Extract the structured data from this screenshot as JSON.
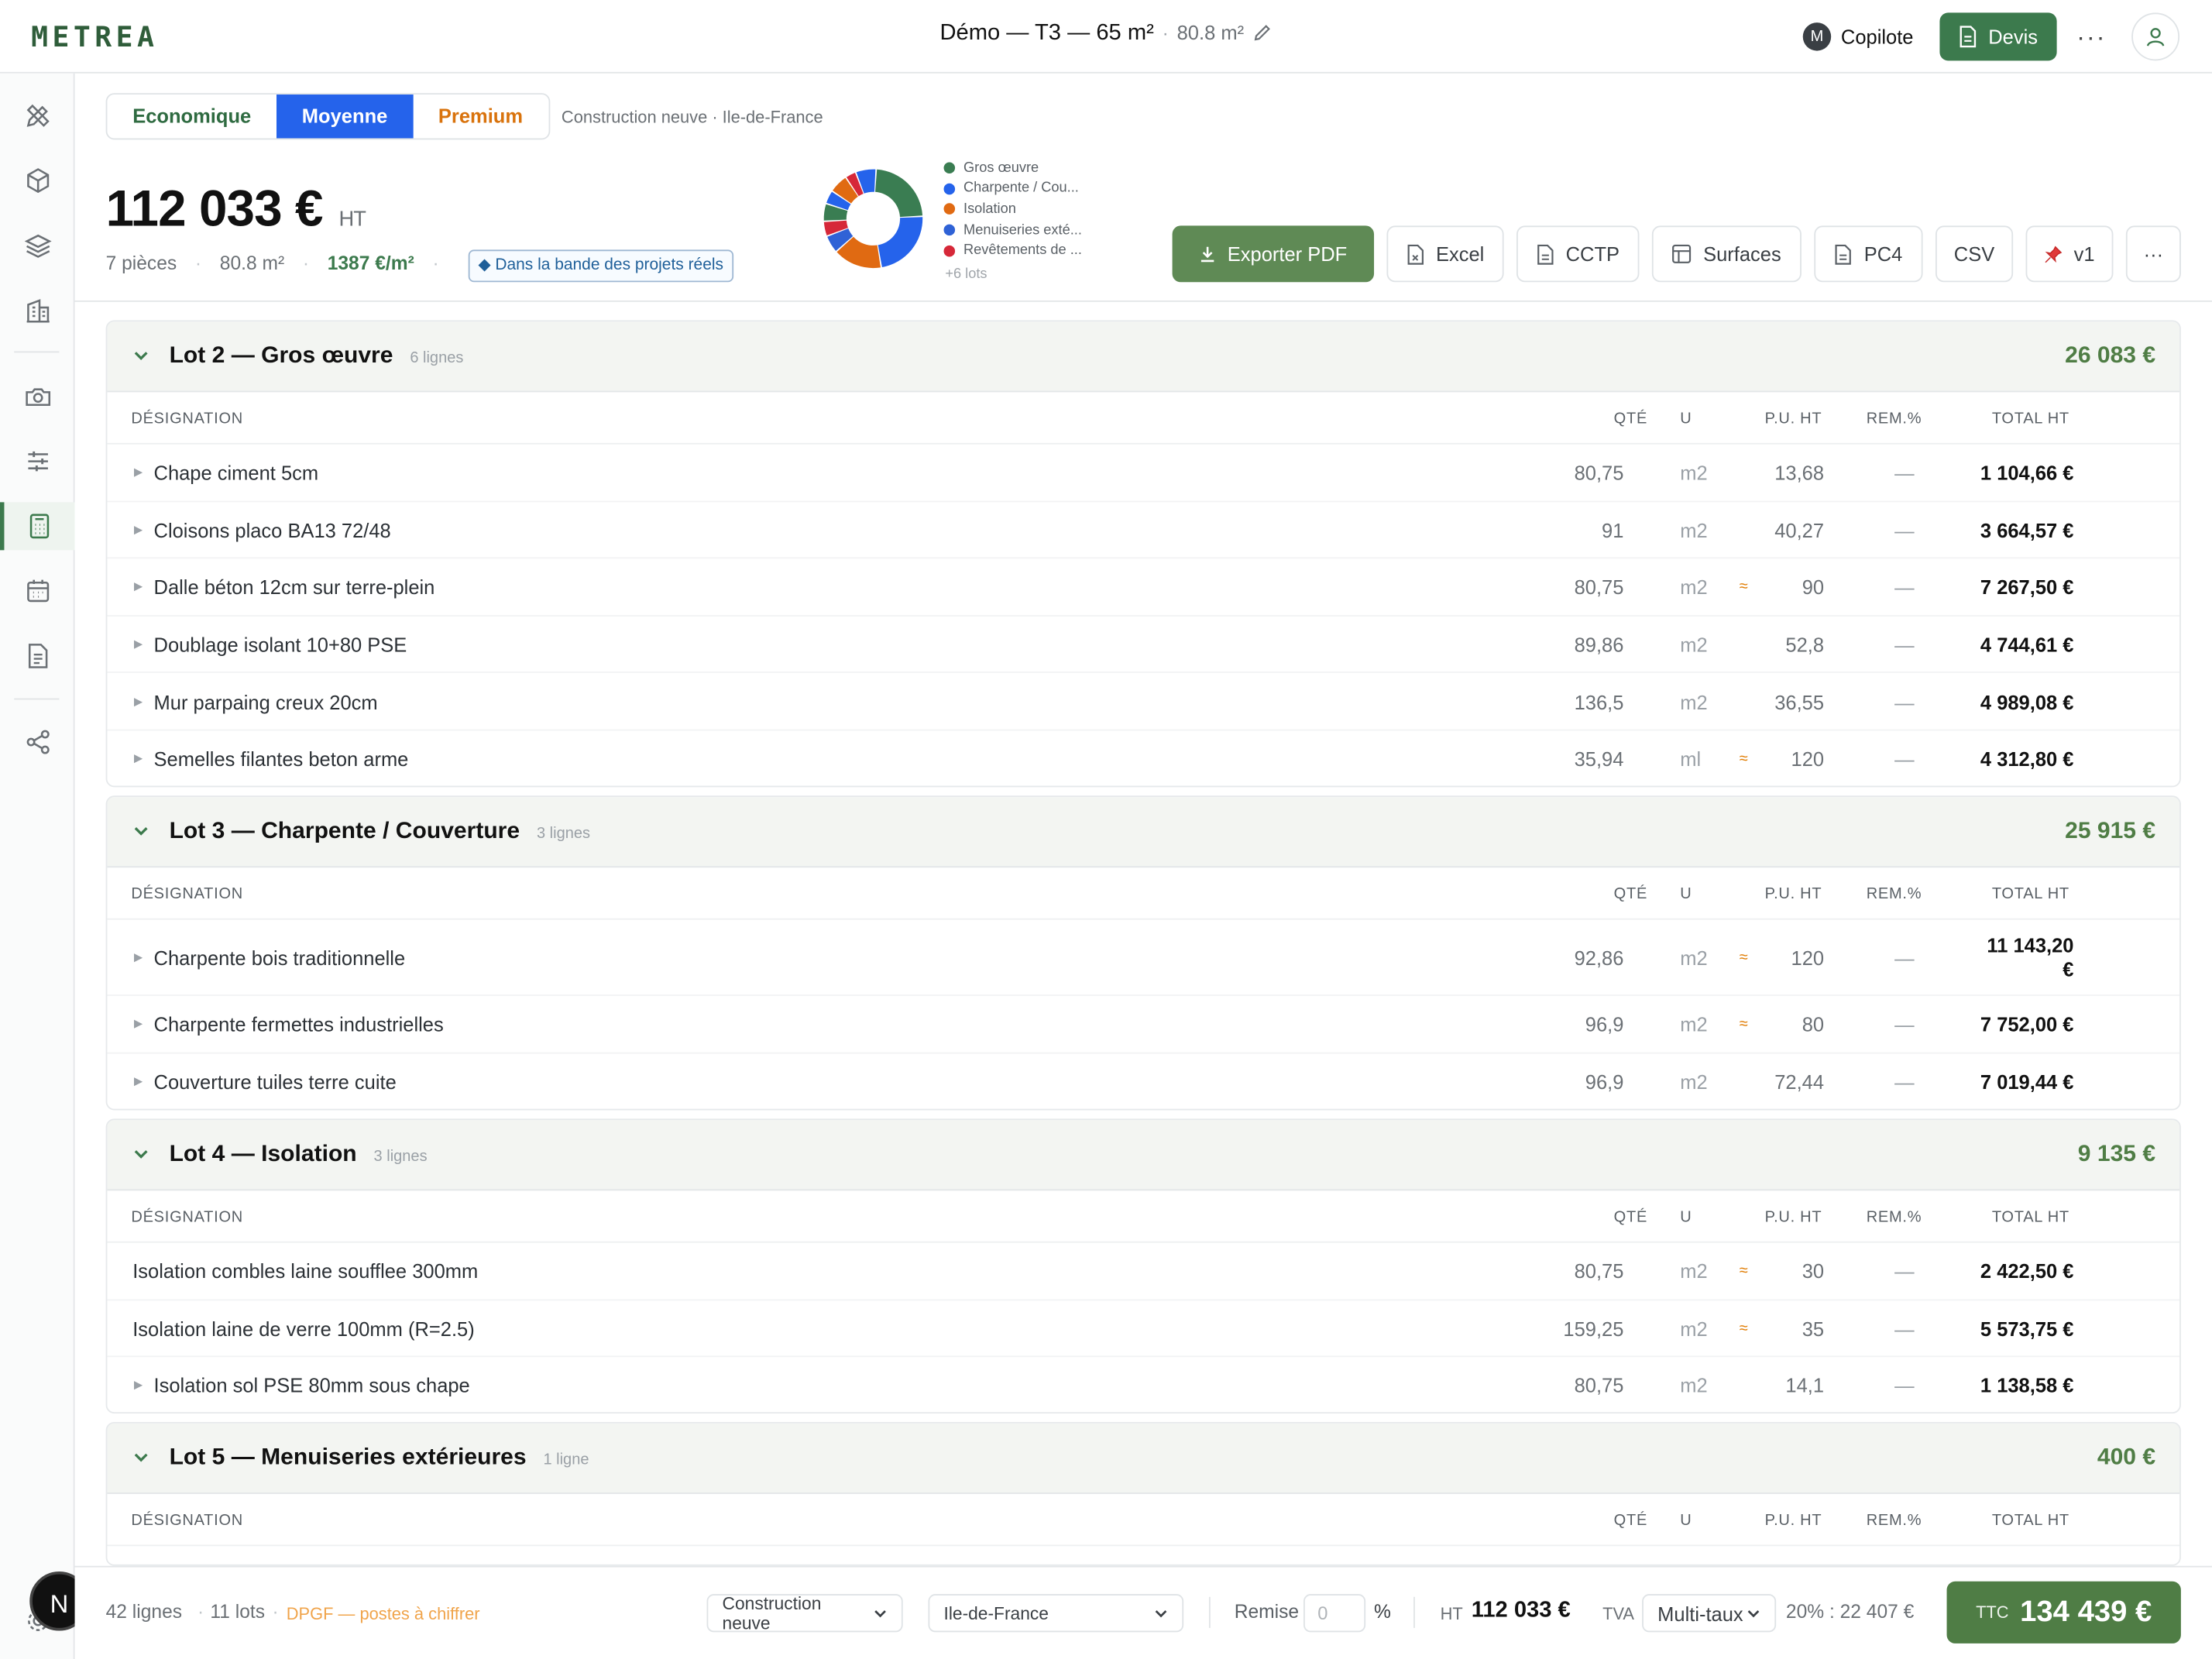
{
  "app": {
    "logo": "METREA"
  },
  "header": {
    "title": "Démo — T3 — 65 m²",
    "area": "80.8 m²",
    "copilot_label": "Copilote",
    "copilot_initial": "M",
    "devis_label": "Devis",
    "more_label": "···"
  },
  "tiers": [
    {
      "label": "Economique"
    },
    {
      "label": "Moyenne"
    },
    {
      "label": "Premium"
    }
  ],
  "context": "Construction neuve · Ile-de-France",
  "summary": {
    "total": "112 033 €",
    "total_suffix": "HT",
    "rooms": "7 pièces",
    "surface": "80.8 m²",
    "price_per_m2": "1387 €/m²",
    "band_badge": "◆ Dans la bande des projets réels"
  },
  "donut": {
    "legend": [
      {
        "label": "Gros œuvre",
        "color": "#3a7d52"
      },
      {
        "label": "Charpente / Cou...",
        "color": "#2563eb"
      },
      {
        "label": "Isolation",
        "color": "#e06a12"
      },
      {
        "label": "Menuiseries exté...",
        "color": "#2f62d6"
      },
      {
        "label": "Revêtements de ...",
        "color": "#d62839"
      }
    ],
    "more": "+6 lots",
    "slices": [
      {
        "color": "#3a7d52",
        "value": 26083
      },
      {
        "color": "#2563eb",
        "value": 25915
      },
      {
        "color": "#e06a12",
        "value": 18000
      },
      {
        "color": "#2f62d6",
        "value": 6500
      },
      {
        "color": "#d62839",
        "value": 5500
      },
      {
        "color": "#3a7d52",
        "value": 6500
      },
      {
        "color": "#2563eb",
        "value": 5000
      },
      {
        "color": "#e06a12",
        "value": 7000
      },
      {
        "color": "#d62839",
        "value": 4000
      },
      {
        "color": "#2563eb",
        "value": 7535
      }
    ]
  },
  "actions": {
    "export_pdf": "Exporter PDF",
    "excel": "Excel",
    "cctp": "CCTP",
    "surfaces": "Surfaces",
    "pc4": "PC4",
    "csv": "CSV",
    "version": "v1",
    "more": "···"
  },
  "columns": {
    "designation": "DÉSIGNATION",
    "qty": "QTÉ",
    "unit": "U",
    "pu": "P.U. HT",
    "rem": "REM.%",
    "total": "TOTAL HT"
  },
  "lots": [
    {
      "title": "Lot 2 — Gros œuvre",
      "count": "6 lignes",
      "total": "26 083 €",
      "rows": [
        {
          "designation": "Chape ciment 5cm",
          "qty": "80,75",
          "unit": "m2",
          "approx": "",
          "pu": "13,68",
          "rem": "—",
          "total": "1 104,66 €"
        },
        {
          "designation": "Cloisons placo BA13 72/48",
          "qty": "91",
          "unit": "m2",
          "approx": "",
          "pu": "40,27",
          "rem": "—",
          "total": "3 664,57 €"
        },
        {
          "designation": "Dalle béton 12cm sur terre-plein",
          "qty": "80,75",
          "unit": "m2",
          "approx": "≈",
          "pu": "90",
          "rem": "—",
          "total": "7 267,50 €"
        },
        {
          "designation": "Doublage isolant 10+80 PSE",
          "qty": "89,86",
          "unit": "m2",
          "approx": "",
          "pu": "52,8",
          "rem": "—",
          "total": "4 744,61 €"
        },
        {
          "designation": "Mur parpaing creux 20cm",
          "qty": "136,5",
          "unit": "m2",
          "approx": "",
          "pu": "36,55",
          "rem": "—",
          "total": "4 989,08 €"
        },
        {
          "designation": "Semelles filantes beton arme",
          "qty": "35,94",
          "unit": "ml",
          "approx": "≈",
          "pu": "120",
          "rem": "—",
          "total": "4 312,80 €"
        }
      ]
    },
    {
      "title": "Lot 3 — Charpente / Couverture",
      "count": "3 lignes",
      "total": "25 915 €",
      "rows": [
        {
          "designation": "Charpente bois traditionnelle",
          "qty": "92,86",
          "unit": "m2",
          "approx": "≈",
          "pu": "120",
          "rem": "—",
          "total": "11 143,20 €"
        },
        {
          "designation": "Charpente fermettes industrielles",
          "qty": "96,9",
          "unit": "m2",
          "approx": "≈",
          "pu": "80",
          "rem": "—",
          "total": "7 752,00 €"
        },
        {
          "designation": "Couverture tuiles terre cuite",
          "qty": "96,9",
          "unit": "m2",
          "approx": "",
          "pu": "72,44",
          "rem": "—",
          "total": "7 019,44 €"
        }
      ]
    },
    {
      "title": "Lot 4 — Isolation",
      "count": "3 lignes",
      "total": "9 135 €",
      "rows": [
        {
          "designation": "Isolation combles laine soufflee 300mm",
          "qty": "80,75",
          "unit": "m2",
          "approx": "≈",
          "pu": "30",
          "rem": "—",
          "total": "2 422,50 €"
        },
        {
          "designation": "Isolation laine de verre 100mm (R=2.5)",
          "qty": "159,25",
          "unit": "m2",
          "approx": "≈",
          "pu": "35",
          "rem": "—",
          "total": "5 573,75 €"
        },
        {
          "designation": "Isolation sol PSE 80mm sous chape",
          "qty": "80,75",
          "unit": "m2",
          "approx": "",
          "pu": "14,1",
          "rem": "—",
          "total": "1 138,58 €"
        }
      ]
    },
    {
      "title": "Lot 5 — Menuiseries extérieures",
      "count": "1 ligne",
      "total": "400 €",
      "rows": []
    }
  ],
  "footer": {
    "lines": "42 lignes",
    "lots": "11 lots",
    "dpgf": "DPGF — postes à chiffrer",
    "type_select": "Construction neuve",
    "region_select": "Ile-de-France",
    "remise_label": "Remise",
    "remise_placeholder": "0",
    "remise_unit": "%",
    "ht_label": "HT",
    "ht_value": "112 033 €",
    "tva_label": "TVA",
    "tva_select": "Multi-taux",
    "tva_detail": "20% : 22 407 €",
    "ttc_label": "TTC",
    "ttc_value": "134 439 €"
  },
  "badge": {
    "letter": "N"
  }
}
